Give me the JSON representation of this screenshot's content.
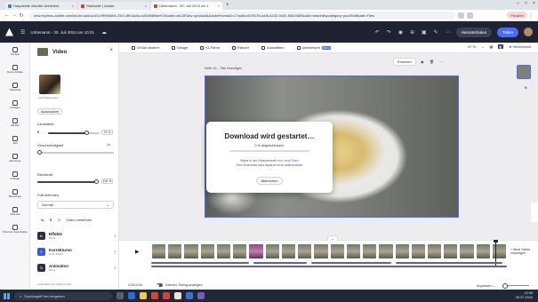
{
  "browser": {
    "tabs": [
      {
        "label": "Hauptseite des/der Anbieters",
        "color": "#3b7ddd"
      },
      {
        "label": "Startseite | Adobe",
        "color": "#e03c31"
      },
      {
        "label": "Unbenannt - 30. Juli 2024 um 1",
        "color": "#e03c31"
      }
    ],
    "url": "new.express.adobe.com/id/urn:aaid:sc:EU:f9956b04-231f-4fbf-8c5a-e28495f6be97/locale=de-DE&sv=product&AdobeHome&t=1?sdid=d578130-a4fd-4242-9432-53b23895c&fe=sharedbycategory=yourStuff&tab=Files",
    "pause_label": "Pausiert"
  },
  "app": {
    "doc_title": "Unbenannt - 30. Juli 2024 um 10:31",
    "download_label": "Herunterladen",
    "share_label": "Teilen"
  },
  "rail": [
    {
      "icon": "search-icon",
      "label": "Suchen"
    },
    {
      "icon": "folder-icon",
      "label": "Deine Inhalte"
    },
    {
      "icon": "home-icon",
      "label": "Startseite"
    },
    {
      "icon": "template-icon",
      "label": "Vorlagen"
    },
    {
      "icon": "media-icon",
      "label": "Medien"
    },
    {
      "icon": "text-icon",
      "label": "Text"
    },
    {
      "icon": "elements-icon",
      "label": "Elemente"
    },
    {
      "icon": "collage-icon",
      "label": "Collage"
    },
    {
      "icon": "brand-icon",
      "label": "Brandings"
    },
    {
      "icon": "addons-icon",
      "label": "Add-ons"
    },
    {
      "icon": "premium-icon",
      "label": "Premium freischalten"
    }
  ],
  "panel": {
    "title": "Video",
    "image_caption": "mit 6 Elementen",
    "replace_label": "Austauschen",
    "volume_label": "Lautstärke",
    "volume_value": "75 %",
    "volume_level": 0.75,
    "speed_label": "Geschwindigkeit",
    "speed_value": "1x",
    "opacity_label": "Deckkraft",
    "opacity_value": "100 %",
    "opacity_level": 1.0,
    "blend_label": "Füllmethoden",
    "blend_value": "Normal",
    "flip_label": "Video umkehren",
    "sections": [
      {
        "label": "Effekte",
        "sub": "Ohne"
      },
      {
        "label": "Korrekturen",
        "sub": "Licht, Farbe"
      },
      {
        "label": "Animation",
        "sub": "Ohne"
      }
    ],
    "footer": "Unterstützt von Adobe Firefly"
  },
  "toolbar": {
    "items": [
      "Größe ändern",
      "Design",
      "KI-Farbe",
      "Ränder",
      "Auswählen",
      "Übersetzen"
    ],
    "beta": "BETA",
    "zoom": "47 %",
    "pages_label": "Verzeichnis"
  },
  "stage": {
    "page_label": "Seite 1/1 – Titel hinzufügen",
    "replace_label": "Ersetzen"
  },
  "dialog": {
    "title": "Download wird gestartet…",
    "progress_text": "0 % abgeschlossen",
    "progress_value": 0.0,
    "line1_prefix": "Starte in der Zwischenzeit",
    "line1_link": "eine neue Datei",
    "line2": "Dein Download wird dadurch nicht unterbrochen",
    "cancel_label": "Abbrechen"
  },
  "timeline": {
    "time": "2:53/3:54",
    "timing_label": "Szenen-Timing anzeigen",
    "zoom_label": "Anpassen",
    "add_scene": "+ Neue Szene hinzufügen",
    "frame_count": 22,
    "pink_frame_index": 6
  },
  "taskbar": {
    "search_placeholder": "Suchbegriff hier eingeben",
    "time": "10:35",
    "date": "30.07.2024"
  }
}
